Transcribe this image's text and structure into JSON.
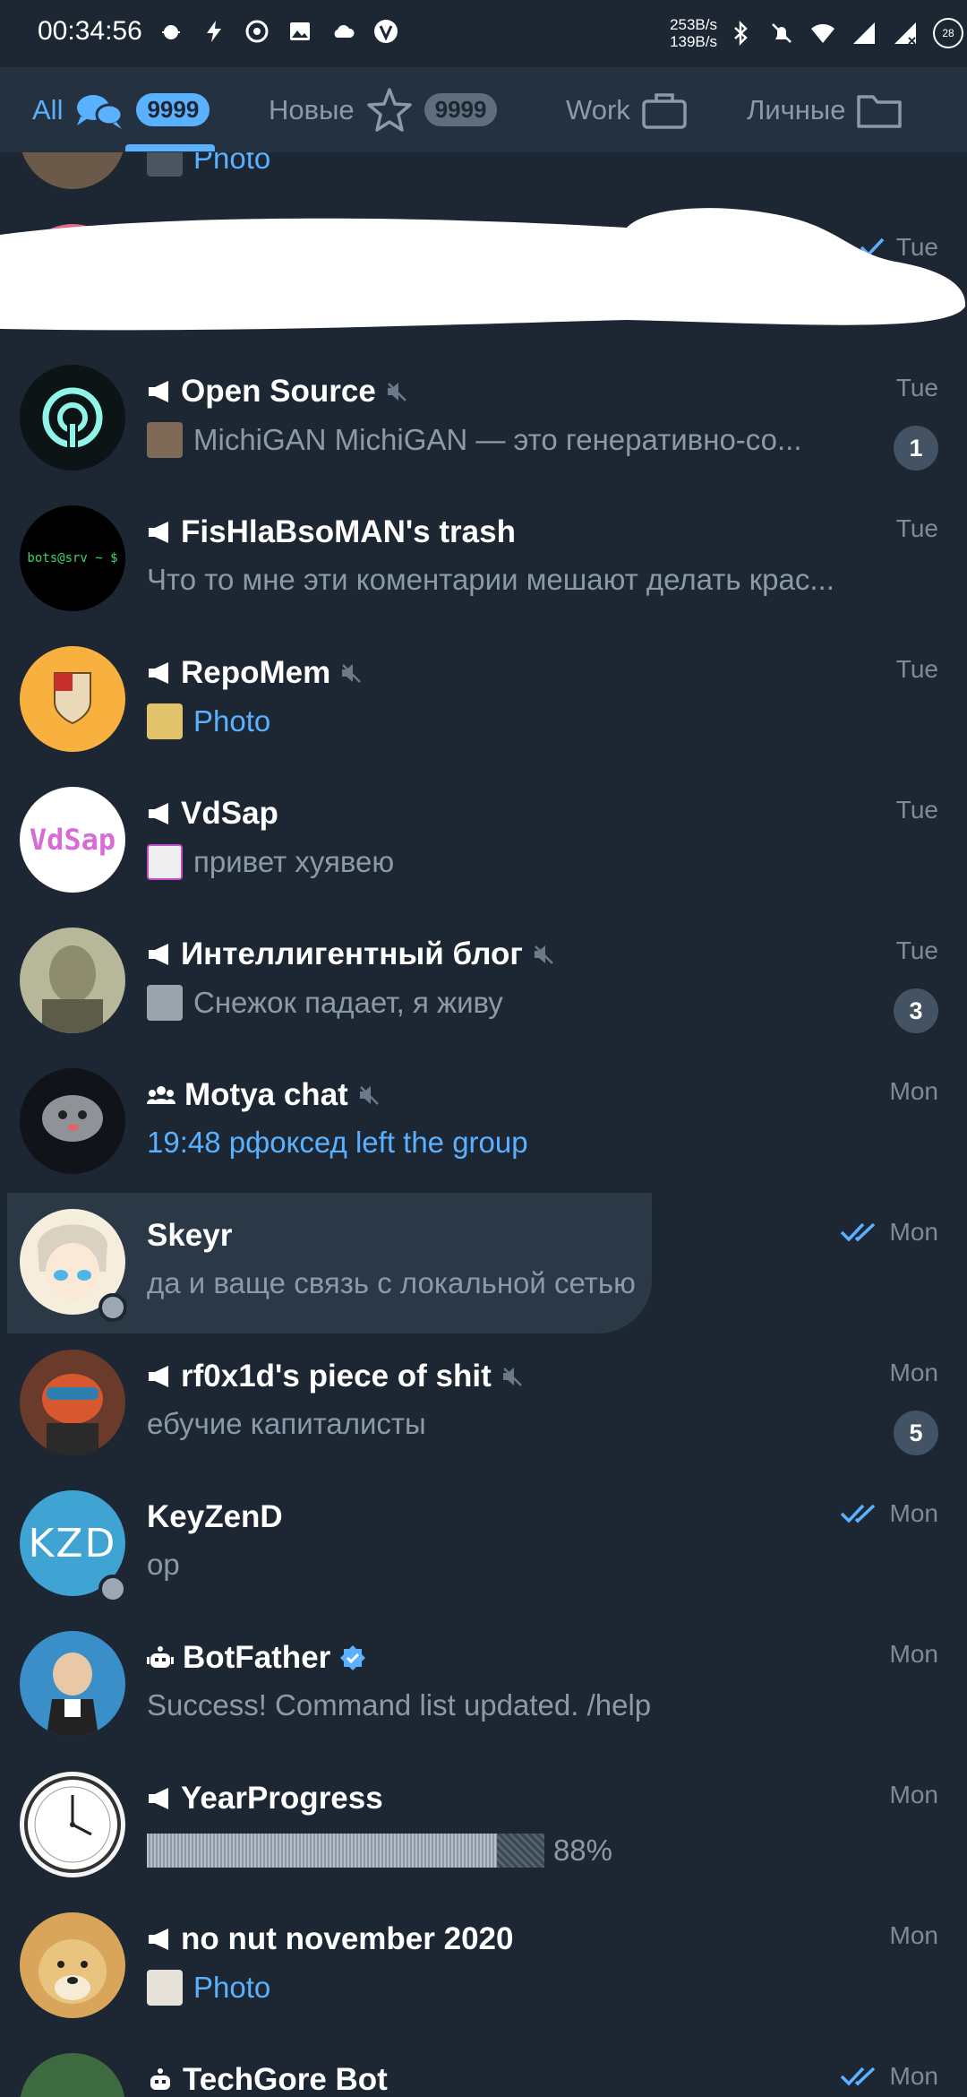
{
  "status_bar": {
    "time": "00:34:56",
    "net_up": "253B/s",
    "net_down": "139B/s",
    "battery": "28"
  },
  "tabs": [
    {
      "label": "All",
      "count": "9999",
      "icon": "chat-bubbles-icon",
      "active": true
    },
    {
      "label": "Новые",
      "count": "9999",
      "icon": "star-icon",
      "active": false
    },
    {
      "label": "Work",
      "icon": "briefcase-icon",
      "active": false
    },
    {
      "label": "Личные",
      "icon": "folder-icon",
      "active": false
    }
  ],
  "chats": [
    {
      "name": "",
      "preview": "Photo",
      "time": "",
      "type": "partial"
    },
    {
      "name": "",
      "preview": "",
      "time": "Tue",
      "read": "single-check",
      "redacted": true
    },
    {
      "name": "Open Source",
      "kind": "channel",
      "muted": true,
      "preview": "MichiGAN  MichiGAN — это генеративно-со...",
      "time": "Tue",
      "unread": "1"
    },
    {
      "name": "FisHlaBsoMAN's trash",
      "kind": "channel",
      "preview": "Что то мне эти коментарии мешают делать крас...",
      "time": "Tue"
    },
    {
      "name": "RepoMem",
      "kind": "channel",
      "muted": true,
      "preview": "Photo",
      "time": "Tue"
    },
    {
      "name": "VdSap",
      "kind": "channel",
      "preview": "привет хуявею",
      "time": "Tue"
    },
    {
      "name": "Интеллигентный блог",
      "kind": "channel",
      "muted": true,
      "preview": "Снежок падает, я живу",
      "time": "Tue",
      "unread": "3"
    },
    {
      "name": "Motya chat",
      "kind": "group",
      "muted": true,
      "preview": "19:48 рфоксед left the group",
      "time": "Mon"
    },
    {
      "name": "Skeyr",
      "kind": "user",
      "preview": "да и ваще связь с локальной сетью",
      "time": "Mon",
      "read": "double-check"
    },
    {
      "name": "rf0x1d's piece of shit",
      "kind": "channel",
      "muted": true,
      "preview": "ебучие капиталисты",
      "time": "Mon",
      "unread": "5"
    },
    {
      "name": "KeyZenD",
      "kind": "user",
      "preview": "ор",
      "time": "Mon",
      "read": "double-check"
    },
    {
      "name": "BotFather",
      "kind": "bot",
      "verified": true,
      "preview": "Success! Command list updated. /help",
      "time": "Mon"
    },
    {
      "name": "YearProgress",
      "kind": "channel",
      "preview": "88%",
      "progress": 0.88,
      "time": "Mon"
    },
    {
      "name": "no nut november 2020",
      "kind": "channel",
      "preview": "Photo",
      "time": "Mon"
    },
    {
      "name": "TechGore Bot",
      "kind": "bot",
      "preview": "",
      "time": "Mon",
      "read": "double-check"
    }
  ],
  "colors": {
    "background": "#1d2733",
    "accent": "#5ab1ff",
    "muted_text": "#8b9aa8",
    "badge": "#435363"
  }
}
